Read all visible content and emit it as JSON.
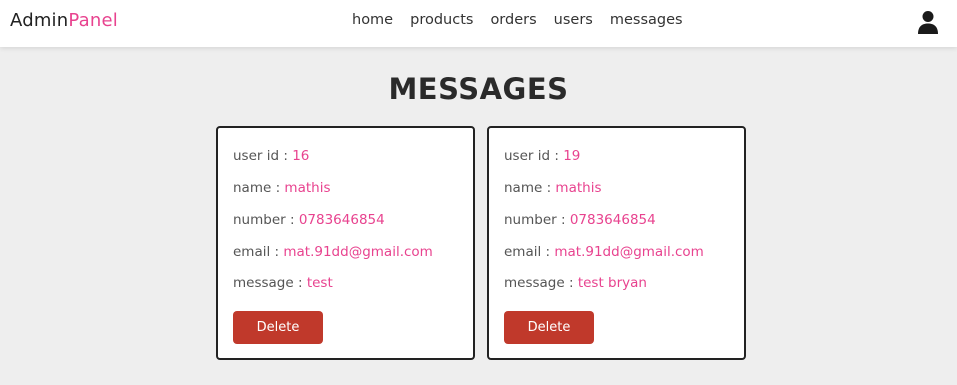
{
  "header": {
    "logo_main": "Admin",
    "logo_accent": "Panel",
    "nav": [
      "home",
      "products",
      "orders",
      "users",
      "messages"
    ],
    "user_icon": "user-icon"
  },
  "page": {
    "title": "MESSAGES"
  },
  "messages": [
    {
      "user_id_label": "user id : ",
      "user_id": "16",
      "name_label": "name : ",
      "name": "mathis",
      "number_label": "number : ",
      "number": "0783646854",
      "email_label": "email : ",
      "email": "mat.91dd@gmail.com",
      "message_label": "message : ",
      "message": "test",
      "delete_label": "Delete"
    },
    {
      "user_id_label": "user id : ",
      "user_id": "19",
      "name_label": "name : ",
      "name": "mathis",
      "number_label": "number : ",
      "number": "0783646854",
      "email_label": "email : ",
      "email": "mat.91dd@gmail.com",
      "message_label": "message : ",
      "message": "test bryan",
      "delete_label": "Delete"
    }
  ],
  "colors": {
    "accent": "#e8438f",
    "delete_button": "#c0392b",
    "background": "#eeeeee"
  }
}
